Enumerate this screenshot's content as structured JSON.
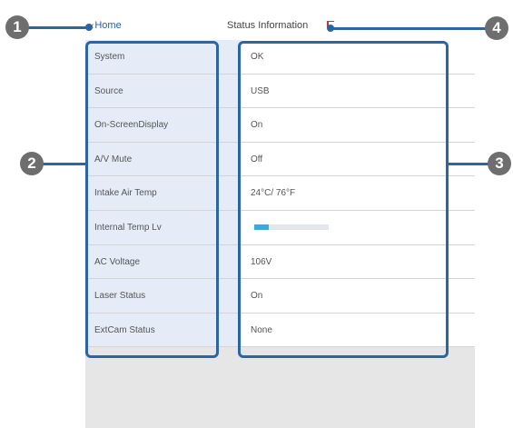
{
  "header": {
    "home_label": "Home",
    "title": "Status Information"
  },
  "rows": [
    {
      "label": "System",
      "value": "OK"
    },
    {
      "label": "Source",
      "value": "USB"
    },
    {
      "label": "On-ScreenDisplay",
      "value": "On"
    },
    {
      "label": "A/V Mute",
      "value": "Off"
    },
    {
      "label": "Intake Air Temp",
      "value": "24°C/ 76°F"
    },
    {
      "label": "Internal Temp Lv",
      "value": "",
      "level_fraction": 0.2
    },
    {
      "label": "AC Voltage",
      "value": "106V"
    },
    {
      "label": "Laser Status",
      "value": "On"
    },
    {
      "label": "ExtCam Status",
      "value": "None"
    }
  ],
  "callouts": [
    "1",
    "2",
    "3",
    "4"
  ],
  "colors": {
    "accent": "#2b65a4",
    "badge": "#6e6e6e",
    "label_bg": "#e5ecf7",
    "temp_fill": "#3aa9df"
  }
}
